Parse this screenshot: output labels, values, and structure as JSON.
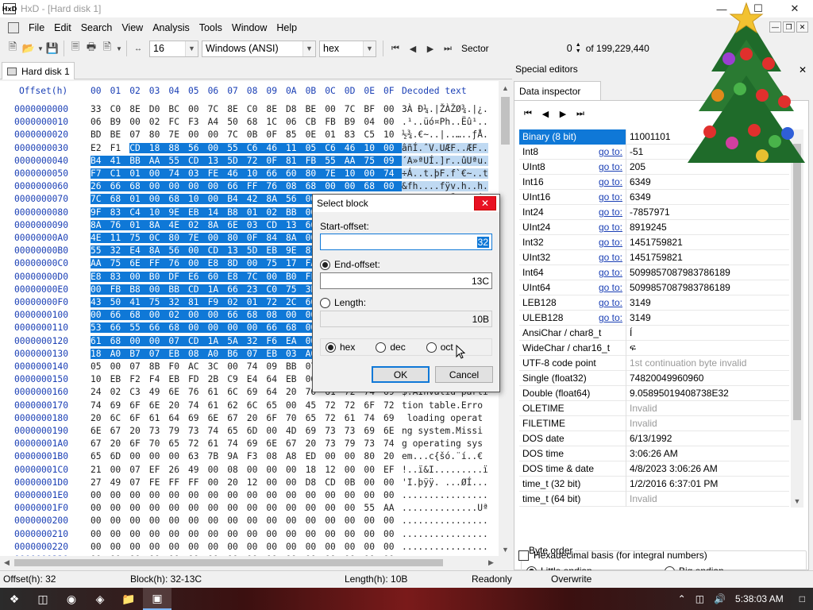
{
  "window": {
    "app_icon": "HxD",
    "title": "HxD - [Hard disk 1]"
  },
  "menu": [
    "File",
    "Edit",
    "Search",
    "View",
    "Analysis",
    "Tools",
    "Window",
    "Help"
  ],
  "toolbar": {
    "bytes_per_row": "16",
    "charset": "Windows (ANSI)",
    "offset_base": "hex",
    "sector_label": "Sector",
    "sector_value": "0",
    "sector_total": "of 199,229,440"
  },
  "tab": {
    "label": "Hard disk 1"
  },
  "hex": {
    "header_offset": "Offset(h)",
    "header_bytes": [
      "00",
      "01",
      "02",
      "03",
      "04",
      "05",
      "06",
      "07",
      "08",
      "09",
      "0A",
      "0B",
      "0C",
      "0D",
      "0E",
      "0F"
    ],
    "header_decoded": "Decoded text",
    "rows": [
      {
        "off": "0000000000",
        "bytes": [
          "33",
          "C0",
          "8E",
          "D0",
          "BC",
          "00",
          "7C",
          "8E",
          "C0",
          "8E",
          "D8",
          "BE",
          "00",
          "7C",
          "BF",
          "00"
        ],
        "text": "3À Ð¼.|ŽÀŽØ¾.|¿."
      },
      {
        "off": "0000000010",
        "bytes": [
          "06",
          "B9",
          "00",
          "02",
          "FC",
          "F3",
          "A4",
          "50",
          "68",
          "1C",
          "06",
          "CB",
          "FB",
          "B9",
          "04",
          "00"
        ],
        "text": ".¹..üó¤Ph..Ëû¹.."
      },
      {
        "off": "0000000020",
        "bytes": [
          "BD",
          "BE",
          "07",
          "80",
          "7E",
          "00",
          "00",
          "7C",
          "0B",
          "0F",
          "85",
          "0E",
          "01",
          "83",
          "C5",
          "10"
        ],
        "text": "½¾.€~..|..…..ƒÅ."
      },
      {
        "off": "0000000030",
        "bytes": [
          "E2",
          "F1",
          "CD",
          "18",
          "88",
          "56",
          "00",
          "55",
          "C6",
          "46",
          "11",
          "05",
          "C6",
          "46",
          "10",
          "00"
        ],
        "text": "âñÍ.ˆV.UÆF..ÆF.."
      },
      {
        "off": "0000000040",
        "bytes": [
          "B4",
          "41",
          "BB",
          "AA",
          "55",
          "CD",
          "13",
          "5D",
          "72",
          "0F",
          "81",
          "FB",
          "55",
          "AA",
          "75",
          "09"
        ],
        "text": "´A»ªUÍ.]r..ûUªu."
      },
      {
        "off": "0000000050",
        "bytes": [
          "F7",
          "C1",
          "01",
          "00",
          "74",
          "03",
          "FE",
          "46",
          "10",
          "66",
          "60",
          "80",
          "7E",
          "10",
          "00",
          "74"
        ],
        "text": "÷Á..t.þF.f`€~..t"
      },
      {
        "off": "0000000060",
        "bytes": [
          "26",
          "66",
          "68",
          "00",
          "00",
          "00",
          "00",
          "66",
          "FF",
          "76",
          "08",
          "68",
          "00",
          "00",
          "68",
          "00"
        ],
        "text": "&fh....fÿv.h..h."
      },
      {
        "off": "0000000070",
        "bytes": [
          "7C",
          "68",
          "01",
          "00",
          "68",
          "10",
          "00",
          "B4",
          "42",
          "8A",
          "56",
          "00",
          "8B",
          "F4",
          "CD",
          "13"
        ],
        "text": "|h..h..´BŠV.‹ôÍ."
      },
      {
        "off": "0000000080",
        "bytes": [
          "9F",
          "83",
          "C4",
          "10",
          "9E",
          "EB",
          "14",
          "B8",
          "01",
          "02",
          "BB",
          "00",
          "7C",
          "8A",
          "56",
          "00"
        ],
        "text": "ŸƒÄ.žë.¸..».|ŠV."
      },
      {
        "off": "0000000090",
        "bytes": [
          "8A",
          "76",
          "01",
          "8A",
          "4E",
          "02",
          "8A",
          "6E",
          "03",
          "CD",
          "13",
          "66",
          "61",
          "73",
          "1C",
          "FE"
        ],
        "text": "Šv.ŠN.Šn.Í.fas.þ"
      },
      {
        "off": "00000000A0",
        "bytes": [
          "4E",
          "11",
          "75",
          "0C",
          "80",
          "7E",
          "00",
          "80",
          "0F",
          "84",
          "8A",
          "00",
          "B2",
          "80",
          "EB",
          "84"
        ],
        "text": "N.u.€~.€.„Š.²€ë„"
      },
      {
        "off": "00000000B0",
        "bytes": [
          "55",
          "32",
          "E4",
          "8A",
          "56",
          "00",
          "CD",
          "13",
          "5D",
          "EB",
          "9E",
          "81",
          "3E",
          "FE",
          "7D",
          "55"
        ],
        "text": "U2äŠV.Í.]ëž.>þ}U"
      },
      {
        "off": "00000000C0",
        "bytes": [
          "AA",
          "75",
          "6E",
          "FF",
          "76",
          "00",
          "E8",
          "8D",
          "00",
          "75",
          "17",
          "FA",
          "B0",
          "D1",
          "E6",
          "64"
        ],
        "text": "ªunÿv.è..u.ú°Ñæd"
      },
      {
        "off": "00000000D0",
        "bytes": [
          "E8",
          "83",
          "00",
          "B0",
          "DF",
          "E6",
          "60",
          "E8",
          "7C",
          "00",
          "B0",
          "FF",
          "E6",
          "64",
          "E8",
          "75"
        ],
        "text": "èƒ.°ßæ`è|.°ÿædèu"
      },
      {
        "off": "00000000E0",
        "bytes": [
          "00",
          "FB",
          "B8",
          "00",
          "BB",
          "CD",
          "1A",
          "66",
          "23",
          "C0",
          "75",
          "3B",
          "66",
          "81",
          "FB",
          "54"
        ],
        "text": ".û¸.»Í.f#Àu;f.ûT"
      },
      {
        "off": "00000000F0",
        "bytes": [
          "43",
          "50",
          "41",
          "75",
          "32",
          "81",
          "F9",
          "02",
          "01",
          "72",
          "2C",
          "66",
          "68",
          "07",
          "BB",
          "00"
        ],
        "text": "CPAu2.ù..r,fh.»."
      },
      {
        "off": "0000000100",
        "bytes": [
          "00",
          "66",
          "68",
          "00",
          "02",
          "00",
          "00",
          "66",
          "68",
          "08",
          "00",
          "00",
          "00",
          "66",
          "53",
          "66"
        ],
        "text": ".fh....fh....fSf"
      },
      {
        "off": "0000000110",
        "bytes": [
          "53",
          "66",
          "55",
          "66",
          "68",
          "00",
          "00",
          "00",
          "00",
          "66",
          "68",
          "00",
          "7C",
          "00",
          "00",
          "66"
        ],
        "text": "SfUfh....fh.|..f"
      },
      {
        "off": "0000000120",
        "bytes": [
          "61",
          "68",
          "00",
          "00",
          "07",
          "CD",
          "1A",
          "5A",
          "32",
          "F6",
          "EA",
          "00",
          "7C",
          "00",
          "00",
          "CD"
        ],
        "text": "ah...Í.Z2öê.|..Í"
      },
      {
        "off": "0000000130",
        "bytes": [
          "18",
          "A0",
          "B7",
          "07",
          "EB",
          "08",
          "A0",
          "B6",
          "07",
          "EB",
          "03",
          "A0",
          "B5",
          "07",
          "32",
          "E4"
        ],
        "text": ". ·.ë. ¶.ë. µ.2ä"
      },
      {
        "off": "0000000140",
        "bytes": [
          "05",
          "00",
          "07",
          "8B",
          "F0",
          "AC",
          "3C",
          "00",
          "74",
          "09",
          "BB",
          "07",
          "00",
          "B4",
          "0E",
          "CD"
        ],
        "text": "...‹ð¬<.t.»..´.Í"
      },
      {
        "off": "0000000150",
        "bytes": [
          "10",
          "EB",
          "F2",
          "F4",
          "EB",
          "FD",
          "2B",
          "C9",
          "E4",
          "64",
          "EB",
          "00",
          "24",
          "02",
          "E0",
          "F8"
        ],
        "text": ".ëòôëý+Éädë.$.àø"
      },
      {
        "off": "0000000160",
        "bytes": [
          "24",
          "02",
          "C3",
          "49",
          "6E",
          "76",
          "61",
          "6C",
          "69",
          "64",
          "20",
          "70",
          "61",
          "72",
          "74",
          "69"
        ],
        "text": "$.ÃInvalid parti"
      },
      {
        "off": "0000000170",
        "bytes": [
          "74",
          "69",
          "6F",
          "6E",
          "20",
          "74",
          "61",
          "62",
          "6C",
          "65",
          "00",
          "45",
          "72",
          "72",
          "6F",
          "72"
        ],
        "text": "tion table.Erro"
      },
      {
        "off": "0000000180",
        "bytes": [
          "20",
          "6C",
          "6F",
          "61",
          "64",
          "69",
          "6E",
          "67",
          "20",
          "6F",
          "70",
          "65",
          "72",
          "61",
          "74",
          "69"
        ],
        "text": " loading operat"
      },
      {
        "off": "0000000190",
        "bytes": [
          "6E",
          "67",
          "20",
          "73",
          "79",
          "73",
          "74",
          "65",
          "6D",
          "00",
          "4D",
          "69",
          "73",
          "73",
          "69",
          "6E"
        ],
        "text": "ng system.Missi"
      },
      {
        "off": "00000001A0",
        "bytes": [
          "67",
          "20",
          "6F",
          "70",
          "65",
          "72",
          "61",
          "74",
          "69",
          "6E",
          "67",
          "20",
          "73",
          "79",
          "73",
          "74"
        ],
        "text": "g operating sys"
      },
      {
        "off": "00000001B0",
        "bytes": [
          "65",
          "6D",
          "00",
          "00",
          "00",
          "63",
          "7B",
          "9A",
          "F3",
          "08",
          "A8",
          "ED",
          "00",
          "00",
          "80",
          "20"
        ],
        "text": "em...c{šó.¨í..€ "
      },
      {
        "off": "00000001C0",
        "bytes": [
          "21",
          "00",
          "07",
          "EF",
          "26",
          "49",
          "00",
          "08",
          "00",
          "00",
          "00",
          "18",
          "12",
          "00",
          "00",
          "EF"
        ],
        "text": "!..ï&I.........ï"
      },
      {
        "off": "00000001D0",
        "bytes": [
          "27",
          "49",
          "07",
          "FE",
          "FF",
          "FF",
          "00",
          "20",
          "12",
          "00",
          "00",
          "D8",
          "CD",
          "0B",
          "00",
          "00"
        ],
        "text": "'I.þÿÿ. ...ØÍ..."
      },
      {
        "off": "00000001E0",
        "bytes": [
          "00",
          "00",
          "00",
          "00",
          "00",
          "00",
          "00",
          "00",
          "00",
          "00",
          "00",
          "00",
          "00",
          "00",
          "00",
          "00"
        ],
        "text": "................"
      },
      {
        "off": "00000001F0",
        "bytes": [
          "00",
          "00",
          "00",
          "00",
          "00",
          "00",
          "00",
          "00",
          "00",
          "00",
          "00",
          "00",
          "00",
          "00",
          "55",
          "AA"
        ],
        "text": "..............Uª"
      },
      {
        "off": "0000000200",
        "bytes": [
          "00",
          "00",
          "00",
          "00",
          "00",
          "00",
          "00",
          "00",
          "00",
          "00",
          "00",
          "00",
          "00",
          "00",
          "00",
          "00"
        ],
        "text": "................"
      },
      {
        "off": "0000000210",
        "bytes": [
          "00",
          "00",
          "00",
          "00",
          "00",
          "00",
          "00",
          "00",
          "00",
          "00",
          "00",
          "00",
          "00",
          "00",
          "00",
          "00"
        ],
        "text": "................"
      },
      {
        "off": "0000000220",
        "bytes": [
          "00",
          "00",
          "00",
          "00",
          "00",
          "00",
          "00",
          "00",
          "00",
          "00",
          "00",
          "00",
          "00",
          "00",
          "00",
          "00"
        ],
        "text": "................"
      },
      {
        "off": "0000000230",
        "bytes": [
          "00",
          "00",
          "00",
          "00",
          "00",
          "00",
          "00",
          "00",
          "00",
          "00",
          "00",
          "00",
          "00",
          "00",
          "00",
          "00"
        ],
        "text": "................"
      }
    ]
  },
  "special_editors": {
    "title": "Special editors",
    "tab": "Data inspector",
    "goto": "go to:",
    "rows": [
      {
        "name": "Binary (8 bit)",
        "value": "11001101",
        "goto": false,
        "hl": true
      },
      {
        "name": "Int8",
        "value": "-51",
        "goto": true
      },
      {
        "name": "UInt8",
        "value": "205",
        "goto": true
      },
      {
        "name": "Int16",
        "value": "6349",
        "goto": true
      },
      {
        "name": "UInt16",
        "value": "6349",
        "goto": true
      },
      {
        "name": "Int24",
        "value": "-7857971",
        "goto": true
      },
      {
        "name": "UInt24",
        "value": "8919245",
        "goto": true
      },
      {
        "name": "Int32",
        "value": "1451759821",
        "goto": true
      },
      {
        "name": "UInt32",
        "value": "1451759821",
        "goto": true
      },
      {
        "name": "Int64",
        "value": "5099857087983786189",
        "goto": true
      },
      {
        "name": "UInt64",
        "value": "5099857087983786189",
        "goto": true
      },
      {
        "name": "LEB128",
        "value": "3149",
        "goto": true
      },
      {
        "name": "ULEB128",
        "value": "3149",
        "goto": true
      },
      {
        "name": "AnsiChar / char8_t",
        "value": "Í",
        "goto": false
      },
      {
        "name": "WideChar / char16_t",
        "value": "ፍ",
        "goto": false
      },
      {
        "name": "UTF-8 code point",
        "value": "1st continuation byte invalid",
        "goto": false,
        "gray": true
      },
      {
        "name": "Single (float32)",
        "value": "74820049960960",
        "goto": false
      },
      {
        "name": "Double (float64)",
        "value": "9.05895019408738E32",
        "goto": false
      },
      {
        "name": "OLETIME",
        "value": "Invalid",
        "goto": false,
        "gray": true
      },
      {
        "name": "FILETIME",
        "value": "Invalid",
        "goto": false,
        "gray": true
      },
      {
        "name": "DOS date",
        "value": "6/13/1992",
        "goto": false
      },
      {
        "name": "DOS time",
        "value": "3:06:26 AM",
        "goto": false
      },
      {
        "name": "DOS time & date",
        "value": "4/8/2023 3:06:26 AM",
        "goto": false
      },
      {
        "name": "time_t (32 bit)",
        "value": "1/2/2016 6:37:01 PM",
        "goto": false
      },
      {
        "name": "time_t (64 bit)",
        "value": "Invalid",
        "goto": false,
        "gray": true
      }
    ],
    "byte_order": {
      "legend": "Byte order",
      "little": "Little endian",
      "big": "Big endian"
    },
    "hex_basis": "Hexadecimal basis (for integral numbers)"
  },
  "status": {
    "offset": "Offset(h): 32",
    "block": "Block(h): 32-13C",
    "length": "Length(h): 10B",
    "readonly": "Readonly",
    "overwrite": "Overwrite"
  },
  "dialog": {
    "title": "Select block",
    "start_label": "Start-offset:",
    "start_value": "32",
    "end_label": "End-offset:",
    "end_value": "13C",
    "length_label": "Length:",
    "length_value": "10B",
    "radio_hex": "hex",
    "radio_dec": "dec",
    "radio_oct": "oct",
    "ok": "OK",
    "cancel": "Cancel"
  },
  "taskbar": {
    "clock": "5:38:03 AM"
  },
  "colors": {
    "selection": "#0f78d7",
    "offset_blue": "#1a3fb5",
    "close_red": "#e81123"
  }
}
